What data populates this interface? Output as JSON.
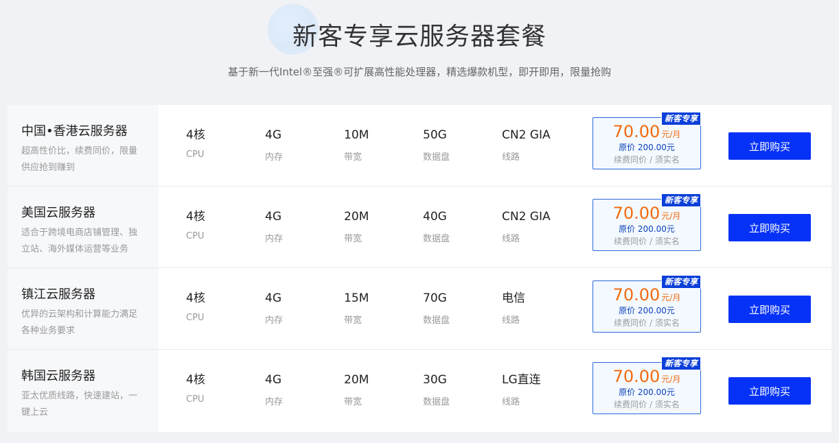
{
  "header": {
    "title": "新客专享云服务器套餐",
    "subtitle": "基于新一代Intel®至强®可扩展高性能处理器，精选爆款机型，即开即用，限量抢购"
  },
  "labels": {
    "cpu": "CPU",
    "memory": "内存",
    "bandwidth": "带宽",
    "disk": "数据盘",
    "route": "线路",
    "badge": "新客专享",
    "price_unit": "元/月",
    "price_note": "续费同价 / 须实名",
    "buy": "立即购买"
  },
  "plans": [
    {
      "name": "中国•香港云服务器",
      "desc": "超高性价比，续费同价，限量供应抢到赚到",
      "cpu": "4核",
      "memory": "4G",
      "bandwidth": "10M",
      "disk": "50G",
      "route": "CN2 GIA",
      "price": "70.00",
      "original_price": "原价 200.00元"
    },
    {
      "name": "美国云服务器",
      "desc": "适合于跨境电商店铺管理、独立站、海外媒体运营等业务",
      "cpu": "4核",
      "memory": "4G",
      "bandwidth": "20M",
      "disk": "40G",
      "route": "CN2 GIA",
      "price": "70.00",
      "original_price": "原价 200.00元"
    },
    {
      "name": "镇江云服务器",
      "desc": "优异的云架构和计算能力满足各种业务要求",
      "cpu": "4核",
      "memory": "4G",
      "bandwidth": "15M",
      "disk": "70G",
      "route": "电信",
      "price": "70.00",
      "original_price": "原价 200.00元"
    },
    {
      "name": "韩国云服务器",
      "desc": "亚太优质线路，快速建站，一键上云",
      "cpu": "4核",
      "memory": "4G",
      "bandwidth": "20M",
      "disk": "30G",
      "route": "LG直连",
      "price": "70.00",
      "original_price": "原价 200.00元"
    }
  ]
}
